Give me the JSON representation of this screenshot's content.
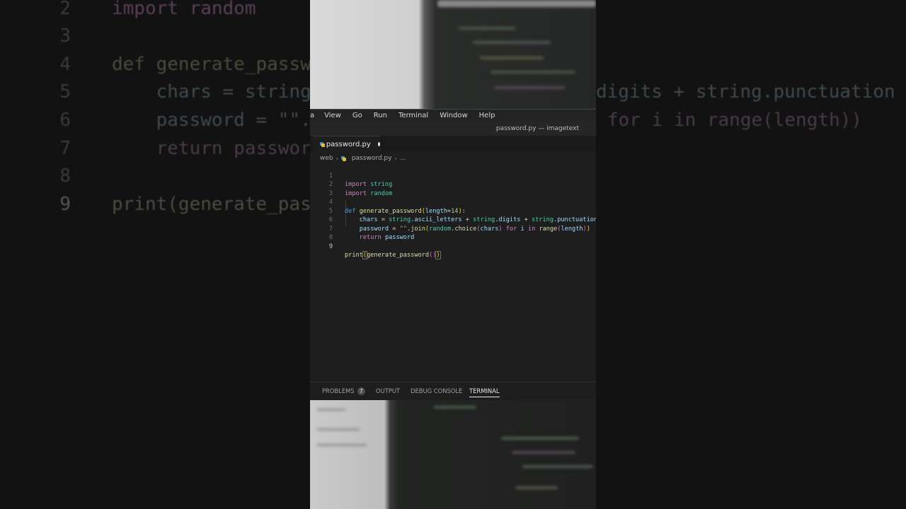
{
  "menu": {
    "items": [
      "View",
      "Go",
      "Run",
      "Terminal",
      "Window",
      "Help"
    ]
  },
  "window": {
    "title": "password.py — imagetext"
  },
  "tab": {
    "label": "password.py"
  },
  "breadcrumb": {
    "folder": "web",
    "file": "password.py",
    "more": "..."
  },
  "editor": {
    "current_line": 9,
    "lines": [
      {
        "n": "1",
        "text": "import string"
      },
      {
        "n": "2",
        "text": "import random"
      },
      {
        "n": "3",
        "text": ""
      },
      {
        "n": "4",
        "text": "def generate_password(length=14):"
      },
      {
        "n": "5",
        "text": "    chars = string.ascii_letters + string.digits + string.punctuation"
      },
      {
        "n": "6",
        "text": "    password = \"\".join(random.choice(chars) for i in range(length))"
      },
      {
        "n": "7",
        "text": "    return password"
      },
      {
        "n": "8",
        "text": ""
      },
      {
        "n": "9",
        "text": "print(generate_password())"
      }
    ]
  },
  "panel": {
    "problems_label": "PROBLEMS",
    "problems_count": "7",
    "output_label": "OUTPUT",
    "debug_label": "DEBUG CONSOLE",
    "terminal_label": "TERMINAL"
  },
  "background_code": {
    "lines": [
      {
        "n": "2",
        "text": "import random"
      },
      {
        "n": "3",
        "text": ""
      },
      {
        "n": "4",
        "text": "def generate_passw"
      },
      {
        "n": "5",
        "text": "    chars = string"
      },
      {
        "n": "6",
        "text": "    password = \"\"."
      },
      {
        "n": "7",
        "text": "    return passwor"
      },
      {
        "n": "8",
        "text": ""
      },
      {
        "n": "9",
        "text": "print(generate_pas"
      }
    ],
    "right_lines": [
      {
        "text": "digits + string.punctuation"
      },
      {
        "text": "for i in range(length))"
      }
    ]
  },
  "colors": {
    "keyword": "#c586c0",
    "def_keyword": "#569cd6",
    "function": "#dcdcaa",
    "variable": "#9cdcfe",
    "module": "#4ec9b0",
    "string": "#ce9178",
    "number": "#b5cea8"
  }
}
